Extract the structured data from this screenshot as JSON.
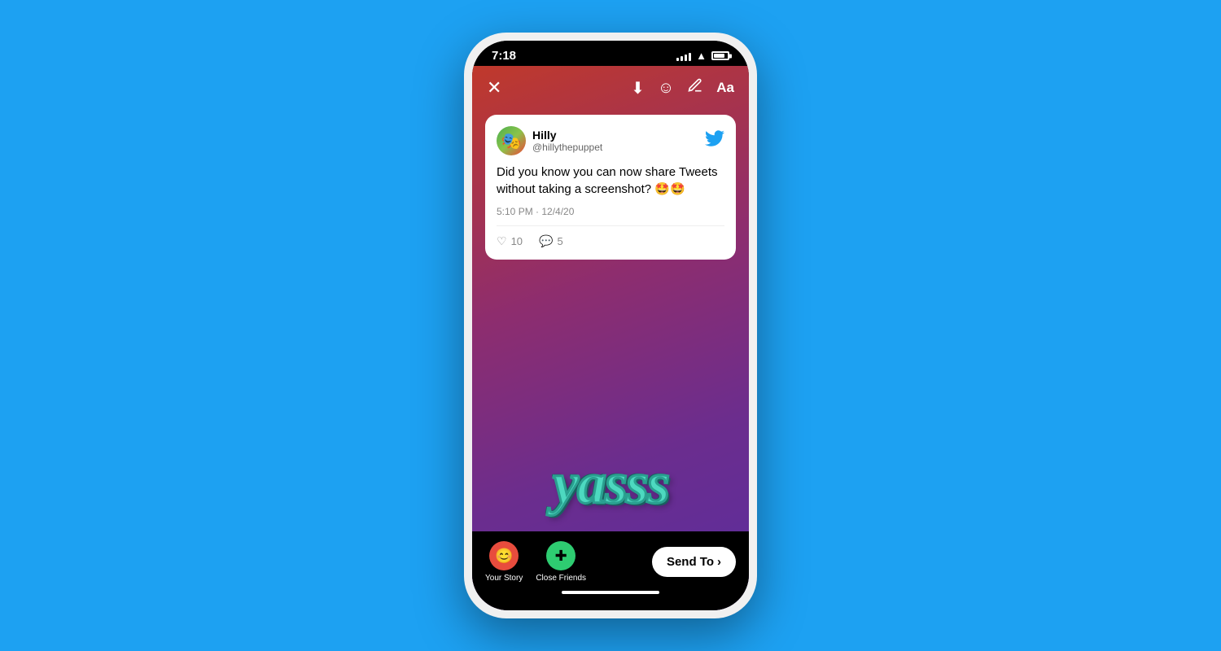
{
  "background": {
    "color": "#1da1f2"
  },
  "status_bar": {
    "time": "7:18",
    "signal_bars": [
      4,
      6,
      8,
      10,
      12
    ],
    "wifi": "wifi",
    "battery": 80
  },
  "topbar": {
    "close_label": "✕",
    "download_icon": "⬇",
    "sticker_icon": "☺",
    "handwriting_icon": "✍",
    "text_icon": "Aa"
  },
  "tweet_card": {
    "user_name": "Hilly",
    "user_handle": "@hillythepuppet",
    "avatar_emoji": "🎭",
    "tweet_text": "Did you know you can now share Tweets without taking a screenshot? 🤩🤩",
    "timestamp": "5:10 PM · 12/4/20",
    "likes_count": "10",
    "comments_count": "5",
    "twitter_bird": "🐦"
  },
  "sticker": {
    "text": "yasss"
  },
  "bottom_bar": {
    "your_story_label": "Your Story",
    "close_friends_label": "Close Friends",
    "send_to_label": "Send To",
    "send_to_arrow": "›"
  }
}
